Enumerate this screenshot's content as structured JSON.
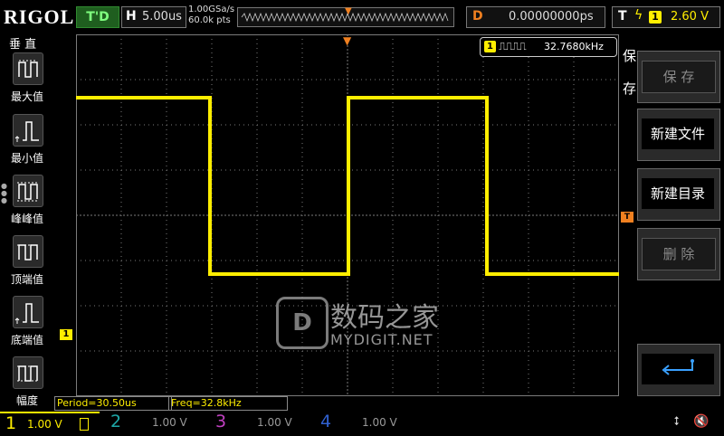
{
  "header": {
    "brand": "RIGOL",
    "run_status": "T'D",
    "timebase_label": "H",
    "timebase_value": "5.00us",
    "sample_rate": "1.00GSa/s",
    "memory_depth": "60.0k pts",
    "delay_label": "D",
    "delay_value": "0.00000000ps",
    "trigger_label": "T",
    "trigger_source": "1",
    "trigger_level": "2.60 V"
  },
  "left_menu": {
    "title": "垂 直",
    "items": [
      {
        "label": "最大值",
        "icon": "max-value-icon"
      },
      {
        "label": "最小值",
        "icon": "min-value-icon"
      },
      {
        "label": "峰峰值",
        "icon": "peak-to-peak-icon"
      },
      {
        "label": "顶端值",
        "icon": "top-value-icon"
      },
      {
        "label": "底端值",
        "icon": "base-value-icon"
      },
      {
        "label": "幅度",
        "icon": "amplitude-icon"
      }
    ]
  },
  "right_menu": {
    "title": "保存",
    "buttons": [
      {
        "label": "保 存",
        "enabled": false
      },
      {
        "label": "新建文件",
        "enabled": true
      },
      {
        "label": "新建目录",
        "enabled": true
      },
      {
        "label": "删 除",
        "enabled": false
      }
    ],
    "return_icon": "return-arrow-icon"
  },
  "waveform": {
    "ch1_marker": "1",
    "frequency_badge_channel": "1",
    "frequency_badge_value": "32.7680kHz",
    "trigger_marker": "T",
    "duty_fraction": 0.5,
    "high_level_div": 2.6,
    "low_level_div": -1.3,
    "colors": {
      "ch1": "#ffee00",
      "trigger": "#f08020",
      "grid": "#7a7a7a"
    }
  },
  "watermark": {
    "cn": "数码之家",
    "en": "MYDIGIT.NET"
  },
  "measurements": {
    "period": "Period=30.50us",
    "freq": "Freq=32.8kHz"
  },
  "channels": [
    {
      "num": "1",
      "scale": "1.00 V",
      "color": "#ffee00"
    },
    {
      "num": "2",
      "scale": "1.00 V",
      "color": "#1ea8a8"
    },
    {
      "num": "3",
      "scale": "1.00 V",
      "color": "#c040c0"
    },
    {
      "num": "4",
      "scale": "1.00 V",
      "color": "#3060d0"
    }
  ]
}
